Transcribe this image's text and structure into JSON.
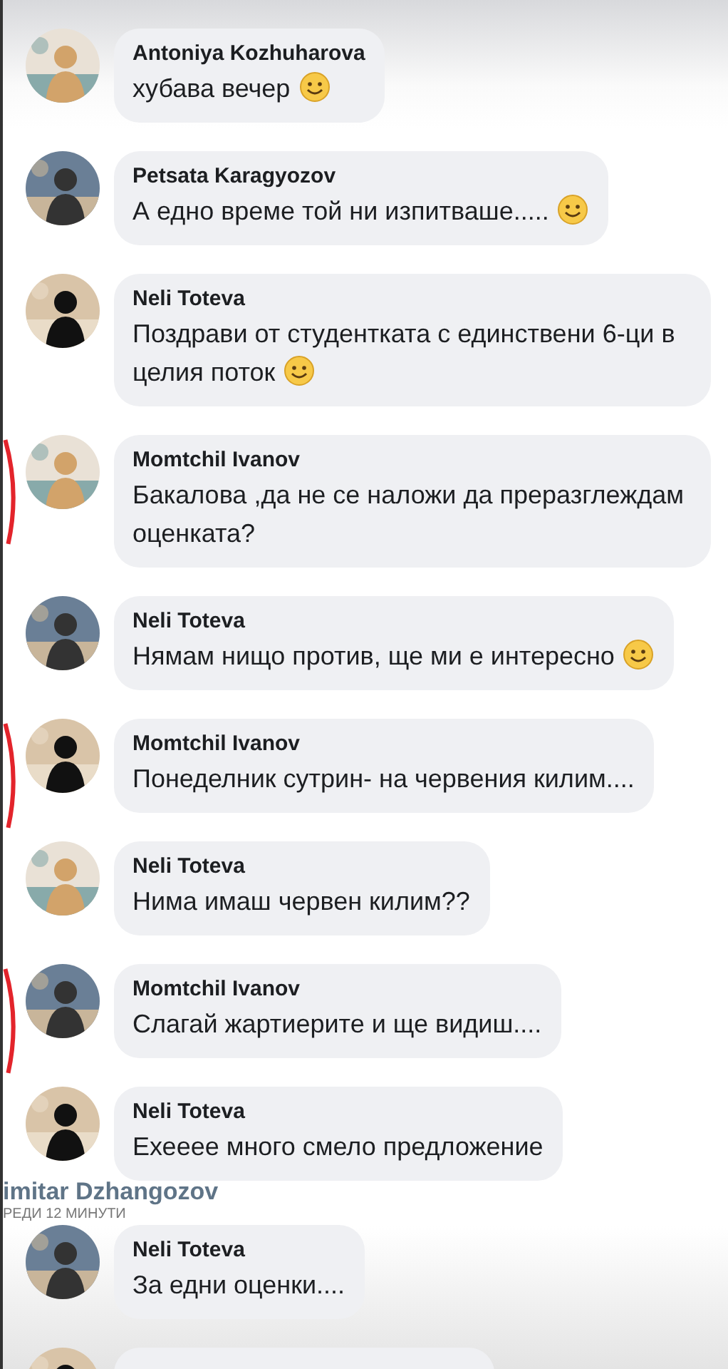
{
  "comments": [
    {
      "kind": "comment",
      "name": "Antoniya Kozhuharova",
      "text": "хубава вечер",
      "smiley": true,
      "marked": false
    },
    {
      "kind": "comment",
      "name": "Petsata Karagyozov",
      "text": "А едно време той ни изпитваше.....",
      "smiley": true,
      "marked": false
    },
    {
      "kind": "comment",
      "name": "Neli Toteva",
      "text": "Поздрави от студентката с единствени 6-ци в целия поток",
      "smiley": true,
      "marked": false
    },
    {
      "kind": "comment",
      "name": "Momtchil Ivanov",
      "text": "Бакалова ,да не се наложи да преразглеждам оценката?",
      "smiley": false,
      "marked": true
    },
    {
      "kind": "comment",
      "name": "Neli Toteva",
      "text": "Нямам нищо против,  ще ми е интересно",
      "smiley": true,
      "marked": false
    },
    {
      "kind": "comment",
      "name": "Momtchil Ivanov",
      "text": "Понеделник сутрин- на червения килим....",
      "smiley": false,
      "marked": true
    },
    {
      "kind": "comment",
      "name": "Neli Toteva",
      "text": "Нима имаш червен килим??",
      "smiley": false,
      "marked": false
    },
    {
      "kind": "comment",
      "name": "Momtchil Ivanov",
      "text": "Слагай жартиерите и ще видиш....",
      "smiley": false,
      "marked": true
    },
    {
      "kind": "comment",
      "name": "Neli Toteva",
      "text": "Ехееее много смело предложение",
      "smiley": false,
      "marked": false
    },
    {
      "kind": "caption",
      "name": "imitar Dzhangozov",
      "text": "РЕДИ 12 МИНУТИ"
    },
    {
      "kind": "comment",
      "name": "Neli Toteva",
      "text": "За едни оценки....",
      "smiley": false,
      "marked": false
    },
    {
      "kind": "cut-off"
    }
  ]
}
